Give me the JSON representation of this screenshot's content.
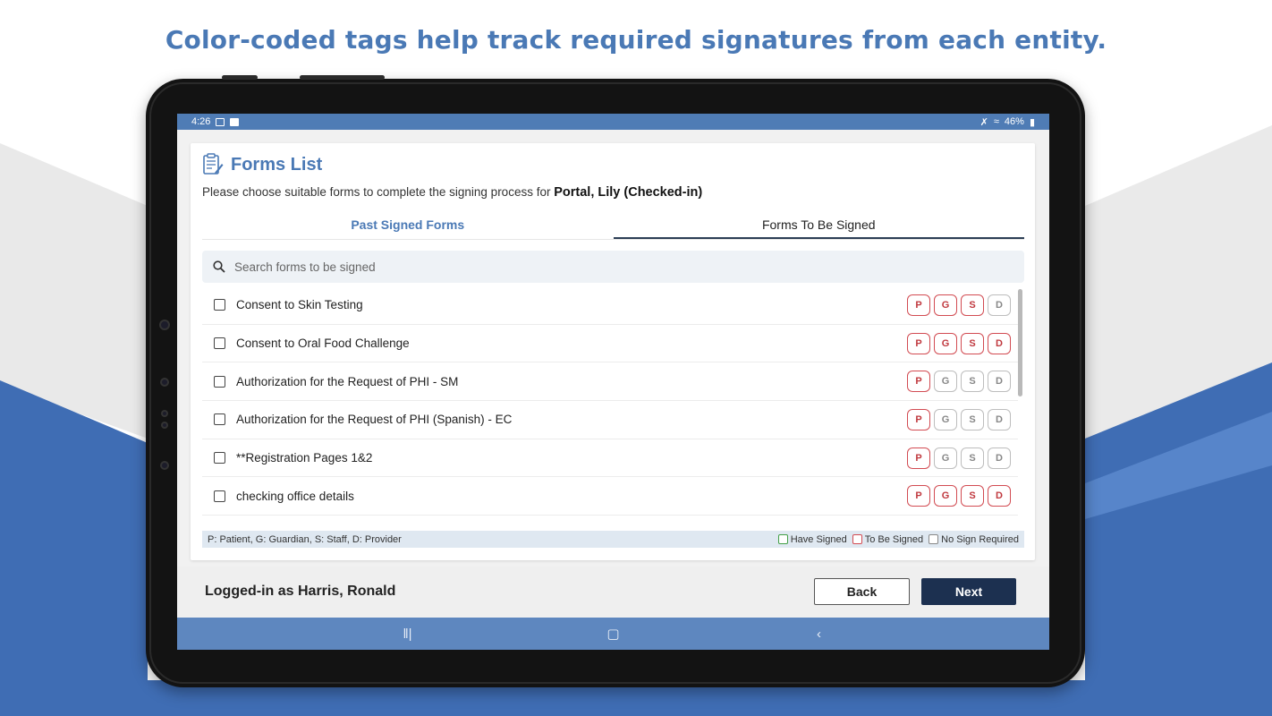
{
  "headline": "Color-coded tags help track required signatures from each entity.",
  "status_bar": {
    "time": "4:26",
    "battery": "46%"
  },
  "header": {
    "title": "Forms List",
    "subtitle_prefix": "Please choose suitable forms to complete the signing process for",
    "patient": "Portal, Lily (Checked-in)"
  },
  "tabs": [
    {
      "label": "Past Signed Forms"
    },
    {
      "label": "Forms To Be Signed"
    }
  ],
  "search": {
    "placeholder": "Search forms to be signed"
  },
  "forms": [
    {
      "label": "Consent to Skin Testing",
      "tags": [
        "P",
        "G",
        "S",
        "D"
      ],
      "tag_state": [
        "red",
        "red",
        "red",
        "gray"
      ]
    },
    {
      "label": "Consent to Oral Food Challenge",
      "tags": [
        "P",
        "G",
        "S",
        "D"
      ],
      "tag_state": [
        "red",
        "red",
        "red",
        "red"
      ]
    },
    {
      "label": "Authorization for the Request of PHI - SM",
      "tags": [
        "P",
        "G",
        "S",
        "D"
      ],
      "tag_state": [
        "red",
        "gray",
        "gray",
        "gray"
      ]
    },
    {
      "label": "Authorization for the Request of PHI (Spanish) - EC",
      "tags": [
        "P",
        "G",
        "S",
        "D"
      ],
      "tag_state": [
        "red",
        "gray",
        "gray",
        "gray"
      ]
    },
    {
      "label": "**Registration Pages 1&2",
      "tags": [
        "P",
        "G",
        "S",
        "D"
      ],
      "tag_state": [
        "red",
        "gray",
        "gray",
        "gray"
      ]
    },
    {
      "label": "checking office details",
      "tags": [
        "P",
        "G",
        "S",
        "D"
      ],
      "tag_state": [
        "red",
        "red",
        "red",
        "red"
      ]
    }
  ],
  "legend": {
    "roles": "P: Patient, G: Guardian, S: Staff, D: Provider",
    "have_signed": "Have Signed",
    "to_be_signed": "To Be Signed",
    "no_sign": "No Sign Required"
  },
  "footer": {
    "logged_in": "Logged-in as Harris, Ronald",
    "back": "Back",
    "next": "Next"
  },
  "colors": {
    "accent": "#4a79b5",
    "tag_red": "#d24b52",
    "tag_gray": "#bdbdbd",
    "have_signed": "#43a047",
    "next_button": "#1c3050"
  }
}
